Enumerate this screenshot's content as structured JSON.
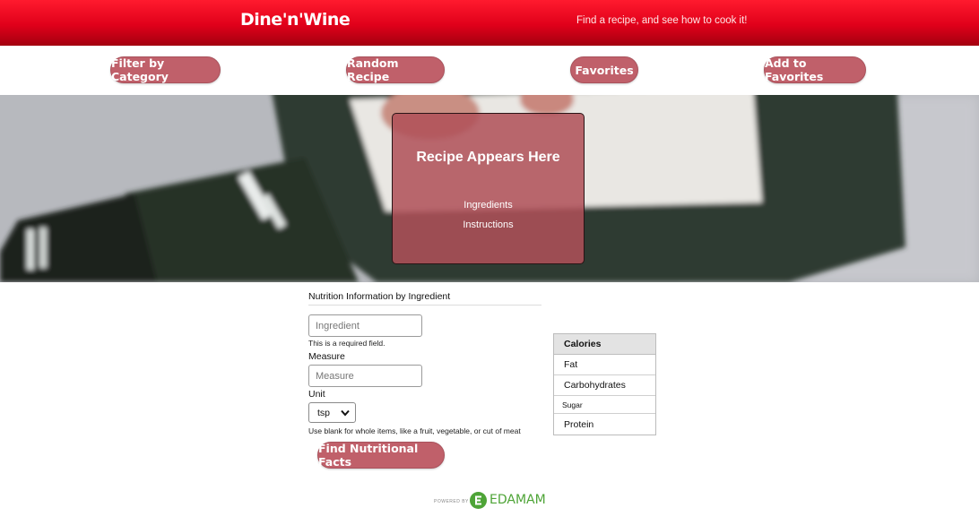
{
  "header": {
    "brand": "Dine'n'Wine",
    "tagline": "Find a recipe, and see how to cook it!"
  },
  "nav": {
    "filter_label": "Filter by Category",
    "random_label": "Random Recipe",
    "favorites_label": "Favorites",
    "add_favorites_label": "Add to Favorites"
  },
  "recipe": {
    "title": "Recipe Appears Here",
    "ingredients_label": "Ingredients",
    "instructions_label": "Instructions"
  },
  "nutrition_form": {
    "title": "Nutrition Information by Ingredient",
    "ingredient_placeholder": "Ingredient",
    "required_note": "This is a required field.",
    "measure_label": "Measure",
    "measure_placeholder": "Measure",
    "unit_label": "Unit",
    "unit_selected": "tsp",
    "unit_note": "Use blank for whole items, like a fruit, vegetable, or cut of meat",
    "submit_label": "Find Nutritional Facts"
  },
  "nutrition_table": {
    "rows": [
      "Calories",
      "Fat",
      "Carbohydrates",
      "Sugar",
      "Protein"
    ]
  },
  "footer": {
    "powered_by": "POWERED BY",
    "brand": "EDAMAM"
  },
  "colors": {
    "header_red": "#e0001a",
    "button_rose": "#c0606a",
    "edamam_green": "#4ea437"
  },
  "icons": {
    "select_arrow": "chevron-down-icon",
    "edamam_logo": "edamam-logo-icon"
  }
}
